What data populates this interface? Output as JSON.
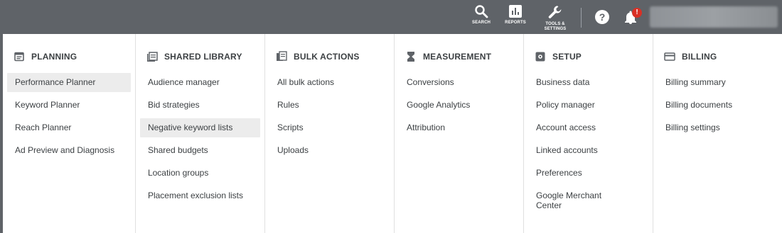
{
  "toolbar": {
    "search_label": "SEARCH",
    "reports_label": "REPORTS",
    "tools_label": "TOOLS &\nSETTINGS",
    "help_glyph": "?",
    "notification_badge": "!"
  },
  "colors": {
    "topbar": "#5f6368",
    "badge": "#d93025",
    "highlight": "#ececec",
    "text": "#3c4043"
  },
  "menu": {
    "columns": [
      {
        "title": "PLANNING",
        "icon": "calendar-icon",
        "items": [
          "Performance Planner",
          "Keyword Planner",
          "Reach Planner",
          "Ad Preview and Diagnosis"
        ]
      },
      {
        "title": "SHARED LIBRARY",
        "icon": "library-icon",
        "items": [
          "Audience manager",
          "Bid strategies",
          "Negative keyword lists",
          "Shared budgets",
          "Location groups",
          "Placement exclusion lists"
        ]
      },
      {
        "title": "BULK ACTIONS",
        "icon": "copy-icon",
        "items": [
          "All bulk actions",
          "Rules",
          "Scripts",
          "Uploads"
        ]
      },
      {
        "title": "MEASUREMENT",
        "icon": "hourglass-icon",
        "items": [
          "Conversions",
          "Google Analytics",
          "Attribution"
        ]
      },
      {
        "title": "SETUP",
        "icon": "setup-icon",
        "items": [
          "Business data",
          "Policy manager",
          "Account access",
          "Linked accounts",
          "Preferences",
          "Google Merchant Center"
        ]
      },
      {
        "title": "BILLING",
        "icon": "credit-card-icon",
        "items": [
          "Billing summary",
          "Billing documents",
          "Billing settings"
        ]
      }
    ]
  }
}
